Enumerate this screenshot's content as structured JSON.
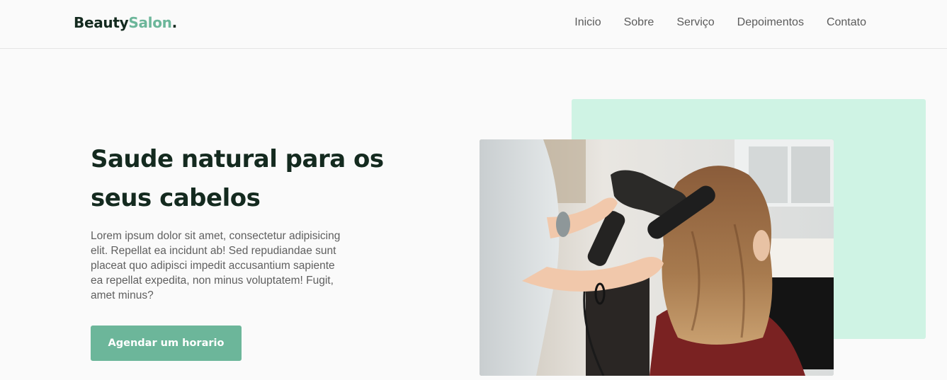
{
  "header": {
    "logo": {
      "part1": "Beauty",
      "part2": "Salon",
      "dot": "."
    },
    "nav": [
      "Inicio",
      "Sobre",
      "Serviço",
      "Depoimentos",
      "Contato"
    ]
  },
  "hero": {
    "title": "Saude natural para os seus cabelos",
    "text": "Lorem ipsum dolor sit amet, consectetur adipisicing elit. Repellat ea incidunt ab! Sed repudiandae sunt placeat quo adipisci impedit accusantium sapiente ea repellat expedita, non minus voluptatem! Fugit, amet minus?",
    "cta_label": "Agendar um horario",
    "image_alt": "Hairdresser blow-drying a client's hair with a round brush"
  },
  "colors": {
    "accent": "#6cb69a",
    "accent_light": "#cff3e4",
    "heading": "#142a1f",
    "background": "#fafafa"
  }
}
